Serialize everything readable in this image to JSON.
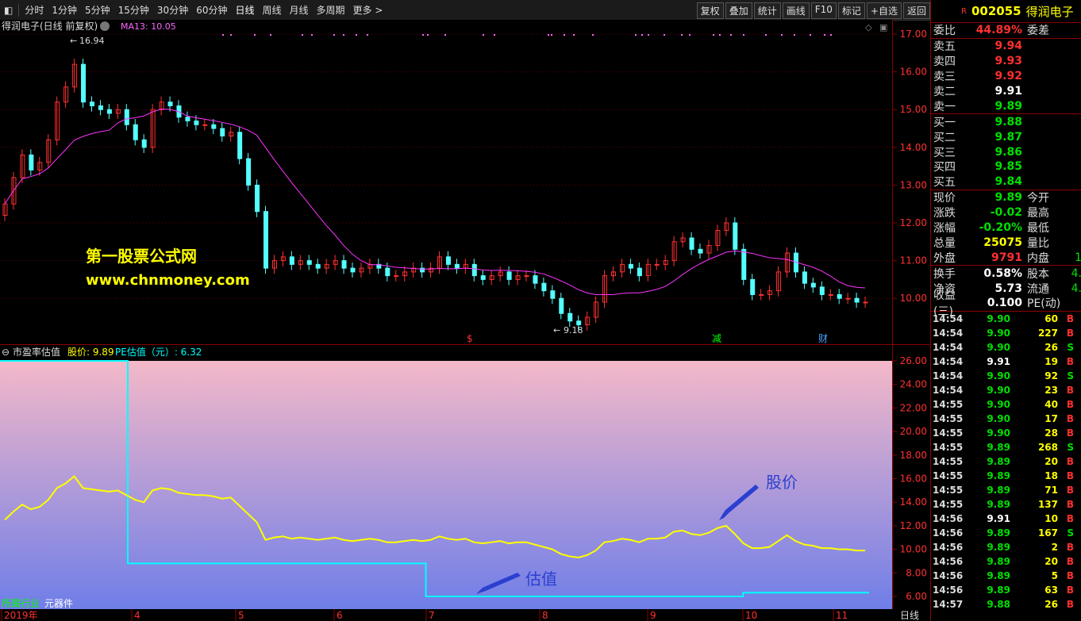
{
  "toolbar": {
    "periods": [
      "分时",
      "1分钟",
      "5分钟",
      "15分钟",
      "30分钟",
      "60分钟",
      "日线",
      "周线",
      "月线",
      "多周期",
      "更多 >"
    ],
    "active_index": 6,
    "right_buttons": [
      "复权",
      "叠加",
      "统计",
      "画线",
      "F10",
      "标记",
      "+自选",
      "返回"
    ]
  },
  "main_chart": {
    "title": "得润电子(日线 前复权)",
    "ma_label": "MA13: 10.05",
    "high_label": "16.94",
    "low_label": "9.18",
    "markers": [
      "$",
      "减",
      "财"
    ],
    "y_ticks": [
      "17.00",
      "16.00",
      "15.00",
      "14.00",
      "13.00",
      "12.00",
      "11.00",
      "10.00"
    ],
    "watermark_name": "第一股票公式网",
    "watermark_url": "www.chnmoney.com"
  },
  "sub_chart": {
    "title": "市盈率估值",
    "price_label": "股价: 9.89",
    "pe_label": "PE估值（元）: 6.32",
    "y_ticks": [
      "26.00",
      "24.00",
      "22.00",
      "20.00",
      "18.00",
      "16.00",
      "14.00",
      "12.00",
      "10.00",
      "8.00",
      "6.00"
    ],
    "annotation_price": "股价",
    "annotation_value": "估值",
    "industry_label": "所属行业",
    "industry_value": "元器件",
    "x_ticks": [
      "2019年",
      "4",
      "5",
      "6",
      "7",
      "8",
      "9",
      "10",
      "11"
    ],
    "period_button": "日线"
  },
  "chart_data": {
    "type": "line",
    "title": "市盈率估值",
    "series": [
      {
        "name": "股价",
        "color": "#ffff00",
        "values": [
          12.5,
          13.2,
          13.8,
          13.4,
          13.6,
          14.2,
          15.2,
          15.6,
          16.2,
          15.2,
          15.1,
          15.0,
          14.9,
          15.0,
          14.6,
          14.2,
          14.0,
          15.0,
          15.2,
          15.1,
          14.8,
          14.7,
          14.6,
          14.6,
          14.5,
          14.3,
          14.4,
          13.7,
          13.0,
          12.3,
          10.8,
          11.0,
          11.1,
          10.9,
          11.0,
          10.9,
          10.8,
          10.9,
          11.0,
          10.8,
          10.7,
          10.8,
          10.9,
          10.8,
          10.6,
          10.6,
          10.7,
          10.8,
          10.7,
          10.8,
          11.1,
          10.9,
          10.8,
          10.9,
          10.6,
          10.5,
          10.6,
          10.7,
          10.5,
          10.6,
          10.6,
          10.4,
          10.2,
          10.0,
          9.6,
          9.4,
          9.3,
          9.5,
          9.9,
          10.6,
          10.7,
          10.9,
          10.8,
          10.6,
          10.9,
          10.9,
          11.0,
          11.5,
          11.6,
          11.3,
          11.2,
          11.4,
          11.8,
          12.0,
          11.3,
          10.5,
          10.1,
          10.1,
          10.2,
          10.7,
          11.2,
          10.7,
          10.4,
          10.3,
          10.1,
          10.1,
          10.0,
          10.0,
          9.9,
          9.9
        ]
      },
      {
        "name": "PE估值（元）",
        "color": "#00ffff",
        "segments": [
          {
            "from": 0,
            "to": 0.147,
            "value": 26.0
          },
          {
            "from": 0.147,
            "to": 0.49,
            "value": 8.8
          },
          {
            "from": 0.49,
            "to": 0.855,
            "value": 6.0
          },
          {
            "from": 0.855,
            "to": 1.0,
            "value": 6.32
          }
        ]
      }
    ],
    "ylim": [
      5.5,
      26.2
    ],
    "x_tick_labels": [
      "2019年",
      "4",
      "5",
      "6",
      "7",
      "8",
      "9",
      "10",
      "11"
    ],
    "legend": "top-left"
  },
  "quote": {
    "code": "002055",
    "name": "得润电子",
    "badge": "R",
    "webi_label": "委比",
    "webi_value": "44.89%",
    "weicha_label": "委差",
    "asks": [
      {
        "label": "卖五",
        "price": "9.94",
        "color": "red"
      },
      {
        "label": "卖四",
        "price": "9.93",
        "color": "red"
      },
      {
        "label": "卖三",
        "price": "9.92",
        "color": "red"
      },
      {
        "label": "卖二",
        "price": "9.91",
        "color": "white"
      },
      {
        "label": "卖一",
        "price": "9.89",
        "color": "green"
      }
    ],
    "bids": [
      {
        "label": "买一",
        "price": "9.88",
        "color": "green"
      },
      {
        "label": "买二",
        "price": "9.87",
        "color": "green"
      },
      {
        "label": "买三",
        "price": "9.86",
        "color": "green"
      },
      {
        "label": "买四",
        "price": "9.85",
        "color": "green"
      },
      {
        "label": "买五",
        "price": "9.84",
        "color": "green"
      }
    ],
    "stats1": [
      {
        "l1": "现价",
        "v1": "9.89",
        "c1": "green",
        "l2": "今开"
      },
      {
        "l1": "涨跌",
        "v1": "-0.02",
        "c1": "green",
        "l2": "最高"
      },
      {
        "l1": "涨幅",
        "v1": "-0.20%",
        "c1": "green",
        "l2": "最低"
      },
      {
        "l1": "总量",
        "v1": "25075",
        "c1": "yellow",
        "l2": "量比"
      },
      {
        "l1": "外盘",
        "v1": "9791",
        "c1": "red",
        "l2": "内盘",
        "v2": "1"
      }
    ],
    "stats2": [
      {
        "l1": "换手",
        "v1": "0.58%",
        "c1": "white",
        "l2": "股本",
        "v2": "4."
      },
      {
        "l1": "净资",
        "v1": "5.73",
        "c1": "white",
        "l2": "流通",
        "v2": "4."
      },
      {
        "l1": "收益(三)",
        "v1": "0.100",
        "c1": "white",
        "l2": "PE(动)"
      }
    ],
    "trades": [
      {
        "t": "14:54",
        "p": "9.90",
        "pc": "green",
        "v": "60",
        "d": "B"
      },
      {
        "t": "14:54",
        "p": "9.90",
        "pc": "green",
        "v": "227",
        "d": "B"
      },
      {
        "t": "14:54",
        "p": "9.90",
        "pc": "green",
        "v": "26",
        "d": "S"
      },
      {
        "t": "14:54",
        "p": "9.91",
        "pc": "white",
        "v": "19",
        "d": "B"
      },
      {
        "t": "14:54",
        "p": "9.90",
        "pc": "green",
        "v": "92",
        "d": "S"
      },
      {
        "t": "14:54",
        "p": "9.90",
        "pc": "green",
        "v": "23",
        "d": "B"
      },
      {
        "t": "14:55",
        "p": "9.90",
        "pc": "green",
        "v": "40",
        "d": "B"
      },
      {
        "t": "14:55",
        "p": "9.90",
        "pc": "green",
        "v": "17",
        "d": "B"
      },
      {
        "t": "14:55",
        "p": "9.90",
        "pc": "green",
        "v": "28",
        "d": "B"
      },
      {
        "t": "14:55",
        "p": "9.89",
        "pc": "green",
        "v": "268",
        "d": "S"
      },
      {
        "t": "14:55",
        "p": "9.89",
        "pc": "green",
        "v": "20",
        "d": "B"
      },
      {
        "t": "14:55",
        "p": "9.89",
        "pc": "green",
        "v": "18",
        "d": "B"
      },
      {
        "t": "14:55",
        "p": "9.89",
        "pc": "green",
        "v": "71",
        "d": "B"
      },
      {
        "t": "14:55",
        "p": "9.89",
        "pc": "green",
        "v": "137",
        "d": "B"
      },
      {
        "t": "14:56",
        "p": "9.91",
        "pc": "white",
        "v": "10",
        "d": "B"
      },
      {
        "t": "14:56",
        "p": "9.89",
        "pc": "green",
        "v": "167",
        "d": "S"
      },
      {
        "t": "14:56",
        "p": "9.89",
        "pc": "green",
        "v": "2",
        "d": "B"
      },
      {
        "t": "14:56",
        "p": "9.89",
        "pc": "green",
        "v": "20",
        "d": "B"
      },
      {
        "t": "14:56",
        "p": "9.89",
        "pc": "green",
        "v": "5",
        "d": "B"
      },
      {
        "t": "14:56",
        "p": "9.89",
        "pc": "green",
        "v": "63",
        "d": "B"
      },
      {
        "t": "14:57",
        "p": "9.88",
        "pc": "green",
        "v": "26",
        "d": "B"
      }
    ]
  }
}
